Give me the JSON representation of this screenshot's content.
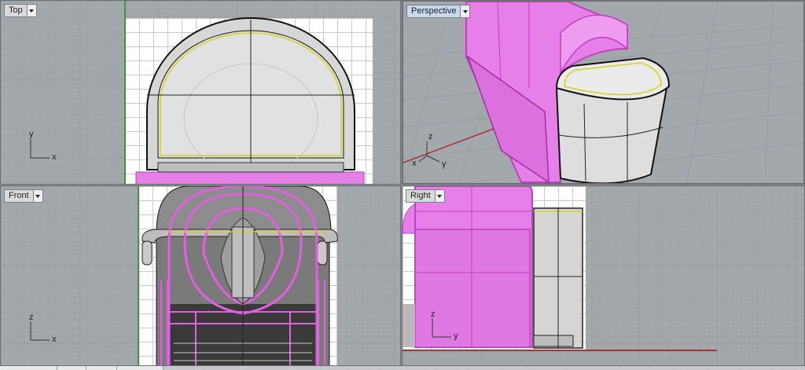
{
  "viewports": {
    "top": {
      "label": "Top",
      "axis_x": "x",
      "axis_y": "y"
    },
    "perspective": {
      "label": "Perspective",
      "axis_x": "x",
      "axis_y": "y",
      "axis_z": "z"
    },
    "front": {
      "label": "Front",
      "axis_x": "x",
      "axis_z": "z"
    },
    "right": {
      "label": "Right",
      "axis_y": "y",
      "axis_z": "z"
    }
  },
  "colors": {
    "viewport_bg": "#a3a8ad",
    "selection": "#e060e0",
    "selection_fill": "#e680e8",
    "yellow_edge": "#d8d020",
    "active_tab": "#c9d8ee"
  }
}
